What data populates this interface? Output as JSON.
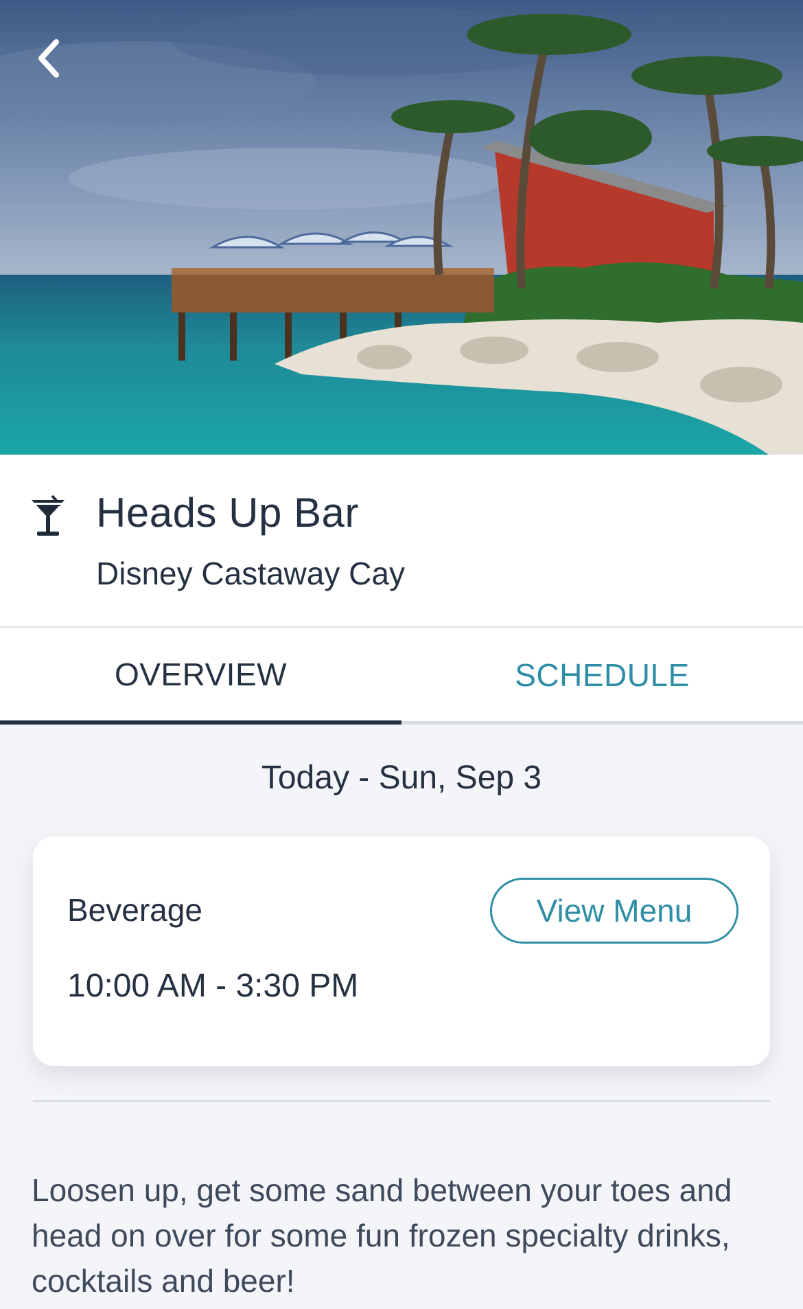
{
  "hero": {
    "image_alt": "",
    "back_icon": "chevron-left-icon"
  },
  "header": {
    "icon": "cocktail-glass-icon",
    "title": "Heads Up Bar",
    "subtitle": "Disney Castaway Cay"
  },
  "tabs": [
    {
      "label": "OVERVIEW",
      "active": true
    },
    {
      "label": "SCHEDULE",
      "active": false
    }
  ],
  "schedule": {
    "date_label": "Today - Sun, Sep 3",
    "card": {
      "type": "Beverage",
      "hours": "10:00 AM - 3:30 PM",
      "button_label": "View Menu"
    }
  },
  "description": "Loosen up, get some sand between your toes and head on over for some fun frozen specialty drinks, cocktails and beer!",
  "colors": {
    "primary_text": "#253142",
    "accent": "#2f8ea6",
    "background": "#f4f5f8"
  }
}
